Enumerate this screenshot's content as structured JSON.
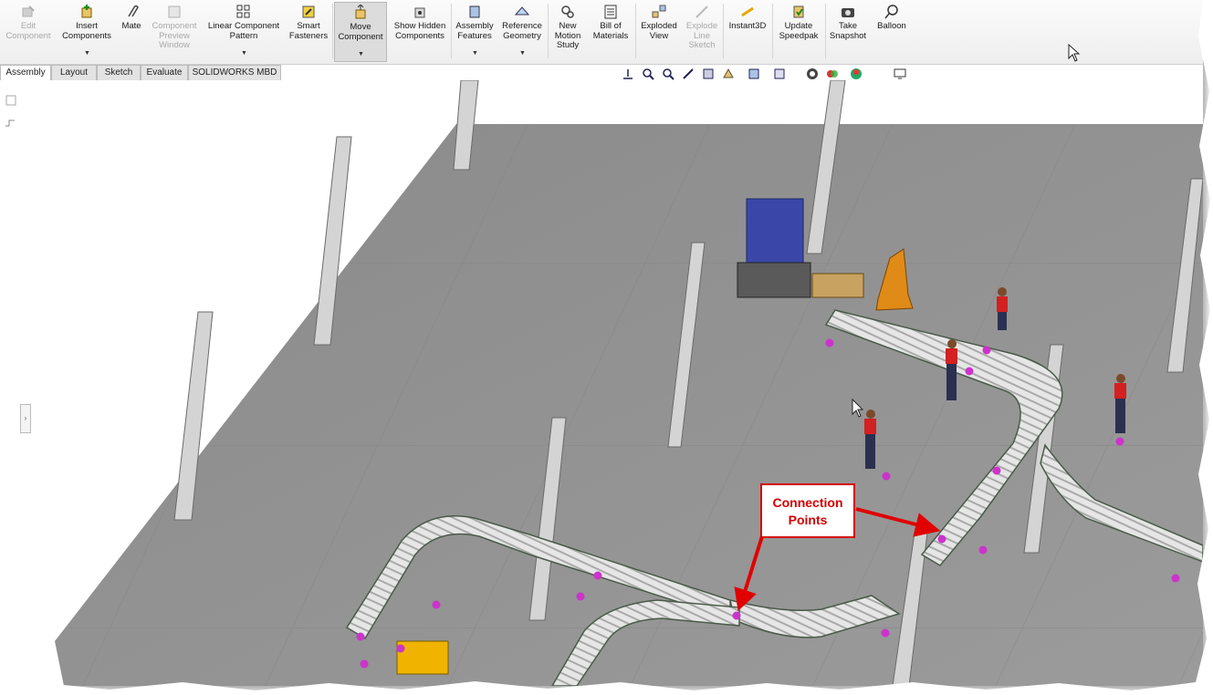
{
  "ribbon": {
    "buttons": [
      {
        "label": "Edit Component",
        "icon": "edit-component-icon",
        "disabled": true
      },
      {
        "label": "Insert Components",
        "icon": "insert-components-icon",
        "dropdown": true
      },
      {
        "label": "Mate",
        "icon": "mate-paperclip-icon"
      },
      {
        "label": "Component Preview Window",
        "icon": "preview-window-icon",
        "disabled": true
      },
      {
        "label": "Linear Component Pattern",
        "icon": "linear-pattern-icon",
        "dropdown": true
      },
      {
        "label": "Smart Fasteners",
        "icon": "smart-fasteners-icon"
      },
      {
        "label": "Move Component",
        "icon": "move-component-icon",
        "dropdown": true,
        "active": true
      },
      {
        "label": "Show Hidden Components",
        "icon": "show-hidden-icon"
      },
      {
        "label": "Assembly Features",
        "icon": "assembly-features-icon",
        "dropdown": true
      },
      {
        "label": "Reference Geometry",
        "icon": "reference-geometry-icon",
        "dropdown": true
      },
      {
        "label": "New Motion Study",
        "icon": "motion-study-icon"
      },
      {
        "label": "Bill of Materials",
        "icon": "bill-of-materials-icon"
      },
      {
        "label": "Exploded View",
        "icon": "exploded-view-icon"
      },
      {
        "label": "Explode Line Sketch",
        "icon": "explode-line-sketch-icon",
        "disabled": true
      },
      {
        "label": "Instant3D",
        "icon": "instant3d-icon"
      },
      {
        "label": "Update Speedpak",
        "icon": "update-speedpak-icon"
      },
      {
        "label": "Take Snapshot",
        "icon": "camera-icon"
      },
      {
        "label": "Balloon",
        "icon": "balloon-icon"
      }
    ]
  },
  "tabs": [
    {
      "label": "Assembly",
      "active": true
    },
    {
      "label": "Layout"
    },
    {
      "label": "Sketch"
    },
    {
      "label": "Evaluate"
    },
    {
      "label": "SOLIDWORKS MBD"
    }
  ],
  "viewbar_icons": [
    "zoom-to-fit-icon",
    "zoom-area-icon",
    "previous-view-icon",
    "section-view-icon",
    "dynamic-annotation-icon",
    "view-orientation-icon",
    "display-style-icon",
    "hide-show-items-icon",
    "edit-appearance-icon",
    "apply-scene-icon",
    "view-settings-icon"
  ],
  "callout": {
    "line1": "Connection",
    "line2": "Points",
    "color": "#d40000"
  },
  "colors": {
    "accent": "#d40000",
    "connection_point": "#cc33cc",
    "floor": "#8f8f8f"
  }
}
